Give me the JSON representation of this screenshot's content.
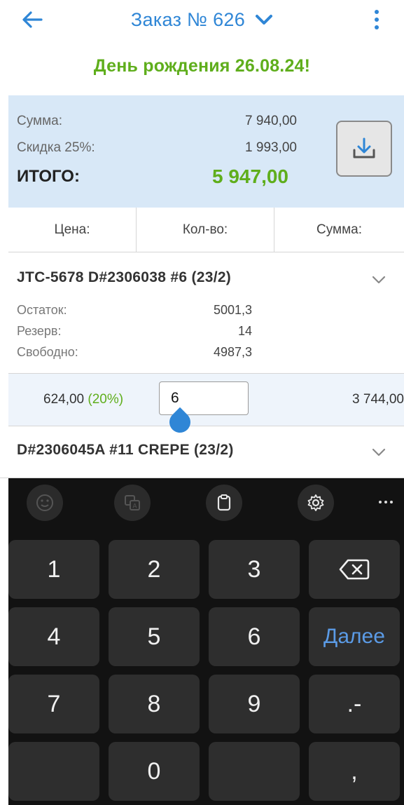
{
  "header": {
    "title": "Заказ № 626",
    "icons": {
      "back": "arrow-left-icon",
      "dropdown": "chevron-down-icon",
      "menu": "more-vertical-icon"
    },
    "accent_color": "#2f86d6"
  },
  "banner": {
    "text": "День рождения 26.08.24!",
    "color": "#5fae1c"
  },
  "summary": {
    "sum_label": "Сумма:",
    "sum_value": "7 940,00",
    "discount_label": "Скидка 25%:",
    "discount_value": "1 993,00",
    "total_label": "ИТОГО:",
    "total_value": "5 947,00",
    "download_icon": "download-icon",
    "background_color": "#d8e8f7"
  },
  "columns": {
    "price": "Цена:",
    "qty": "Кол-во:",
    "sum": "Сумма:"
  },
  "items": [
    {
      "title": "JTC-5678 D#2306038 #6 (23/2)",
      "stock": [
        {
          "label": "Остаток:",
          "value": "5001,3"
        },
        {
          "label": "Резерв:",
          "value": "14"
        },
        {
          "label": "Свободно:",
          "value": "4987,3"
        }
      ],
      "price": "624,00",
      "discount": "(20%)",
      "qty": "6",
      "sum": "3 744,00"
    },
    {
      "title": "D#2306045A #11 CREPE (23/2)"
    }
  ],
  "keyboard": {
    "toolbar_icons": [
      "emoji-icon",
      "translate-icon",
      "clipboard-icon",
      "settings-icon",
      "more-horizontal-icon"
    ],
    "keys": [
      [
        "1",
        "2",
        "3",
        "backspace"
      ],
      [
        "4",
        "5",
        "6",
        "Далее"
      ],
      [
        "7",
        "8",
        "9",
        ".-"
      ],
      [
        "",
        "0",
        "",
        ","
      ]
    ]
  }
}
